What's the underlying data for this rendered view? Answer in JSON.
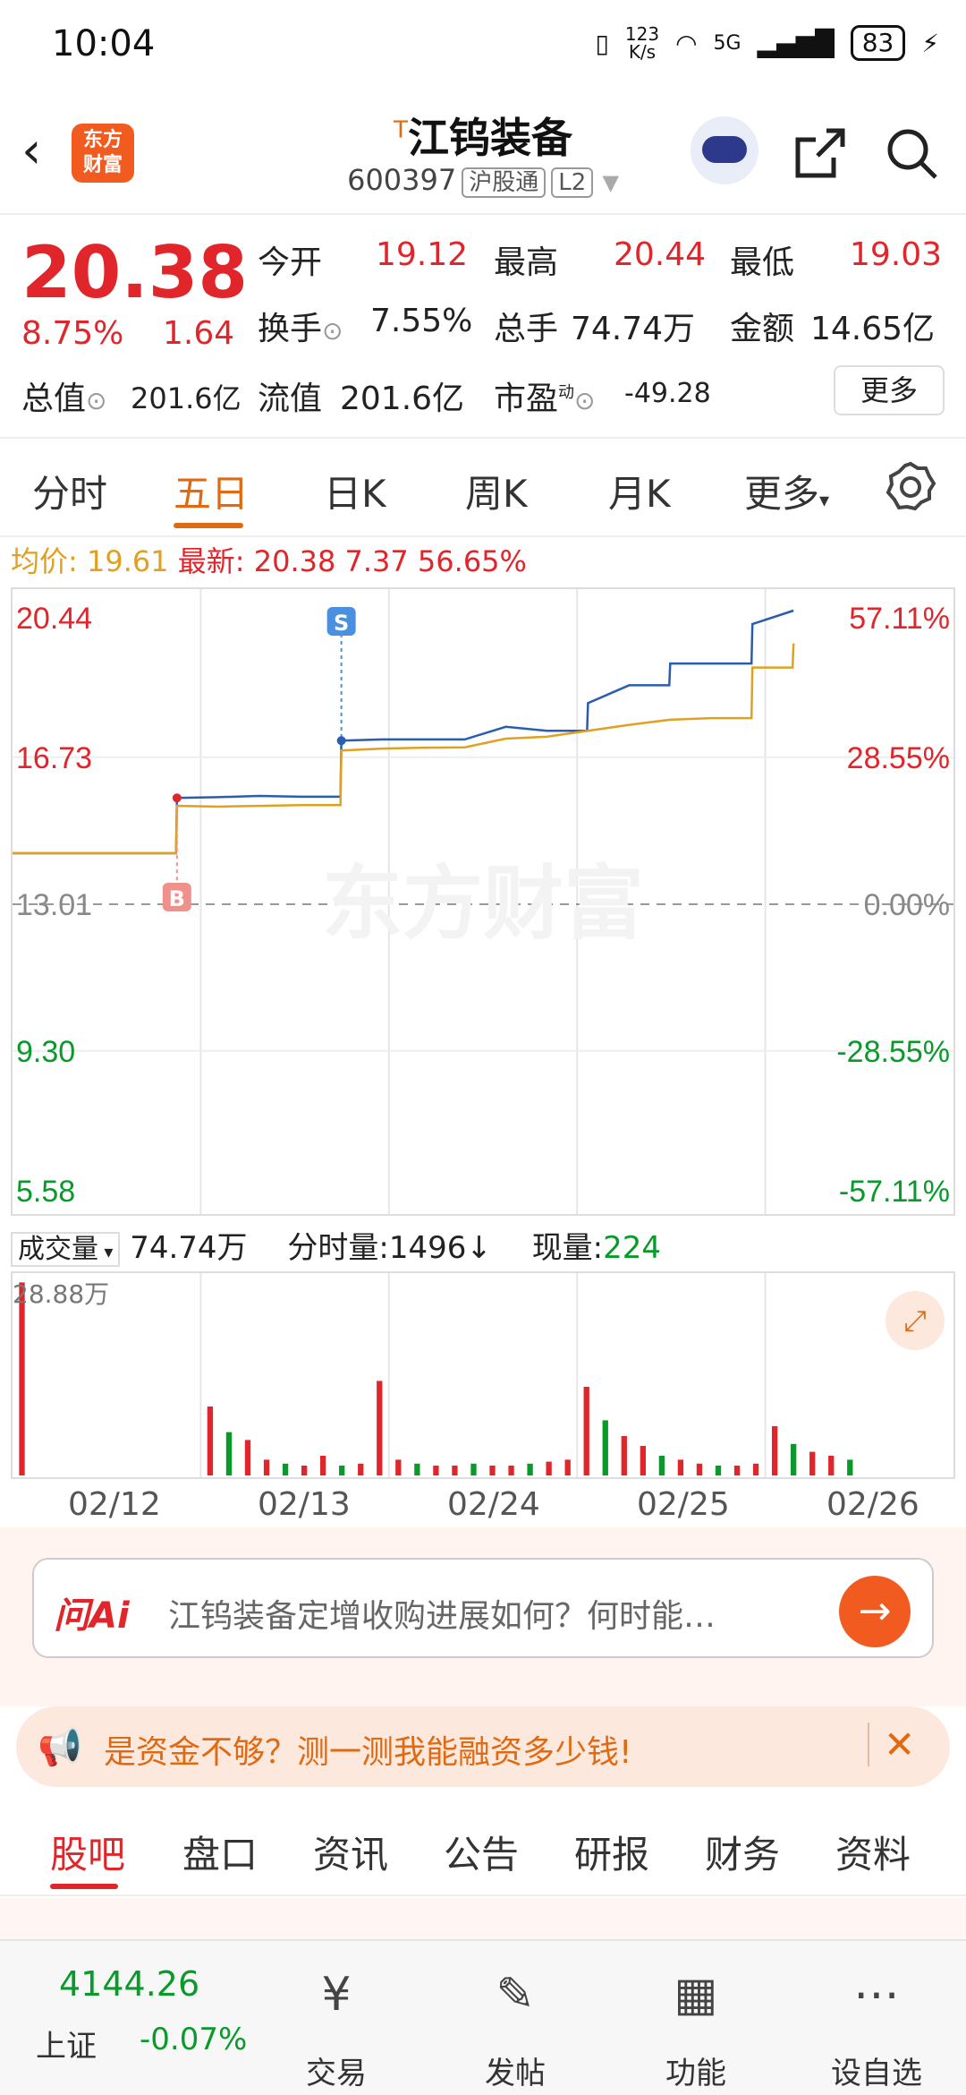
{
  "status": {
    "time": "10:04",
    "net_speed_top": "123",
    "net_speed_bottom": "K/s",
    "signal": "5G",
    "battery": "83"
  },
  "header": {
    "logo_line1": "东方",
    "logo_line2": "财富",
    "title_prefix": "T",
    "title": "江钨装备",
    "code": "600397",
    "tag1": "沪股通",
    "tag2": "L2"
  },
  "quote": {
    "price": "20.38",
    "pct": "8.75%",
    "change": "1.64",
    "open_label": "今开",
    "open": "19.12",
    "high_label": "最高",
    "high": "20.44",
    "low_label": "最低",
    "low": "19.03",
    "turnover_label": "换手",
    "turnover": "7.55%",
    "volume_label": "总手",
    "volume": "74.74万",
    "amount_label": "金额",
    "amount": "14.65亿",
    "mcap_label": "总值",
    "mcap": "201.6亿",
    "float_label": "流值",
    "float": "201.6亿",
    "pe_label": "市盈",
    "pe_sup": "动",
    "pe": "-49.28",
    "more": "更多"
  },
  "tabs": [
    "分时",
    "五日",
    "日K",
    "周K",
    "月K",
    "更多"
  ],
  "avg": {
    "avg_label": "均价:",
    "avg": "19.61",
    "last_label": "最新:",
    "last": "20.38",
    "chg": "7.37",
    "pct": "56.65%"
  },
  "chart_data": {
    "type": "line",
    "title": "",
    "xlabel": "",
    "ylabel": "",
    "categories": [
      "02/12",
      "02/13",
      "02/24",
      "02/25",
      "02/26"
    ],
    "y_left_ticks": [
      "20.44",
      "16.73",
      "13.01",
      "9.30",
      "5.58"
    ],
    "y_right_ticks": [
      "57.11%",
      "28.55%",
      "0.00%",
      "-28.55%",
      "-57.11%"
    ],
    "ylim": [
      5.58,
      20.44
    ],
    "prev_close": 13.01,
    "series": [
      {
        "values": [
          14.3,
          14.3,
          14.3,
          14.3,
          15.7,
          15.72,
          15.75,
          15.73,
          17.15,
          17.18,
          17.18,
          17.18,
          17.5,
          17.4,
          18.1,
          18.55,
          19.1,
          19.1,
          20.1,
          20.44
        ]
      },
      {
        "values": [
          14.3,
          14.3,
          14.3,
          14.3,
          15.5,
          15.48,
          15.5,
          15.52,
          16.9,
          16.95,
          16.97,
          16.98,
          17.2,
          17.25,
          17.4,
          17.55,
          17.68,
          17.72,
          19.0,
          19.61
        ]
      }
    ],
    "markers": [
      "B",
      "S"
    ],
    "watermark": "东方财富",
    "volume": {
      "label": "成交量",
      "total": "74.74万",
      "min_label": "分时量:",
      "min_value": "1496",
      "now_label": "现量:",
      "now_value": "224",
      "max_label": "28.88万",
      "days": [
        {
          "bars": [
            0.98,
            0.0,
            0.0,
            0.0,
            0.0,
            0.0,
            0.0,
            0.0,
            0.0,
            0.0
          ]
        },
        {
          "bars": [
            0.35,
            0.22,
            0.18,
            0.08,
            0.06,
            0.05,
            0.1,
            0.05,
            0.06,
            0.48
          ]
        },
        {
          "bars": [
            0.08,
            0.06,
            0.05,
            0.05,
            0.06,
            0.05,
            0.05,
            0.06,
            0.07,
            0.08
          ]
        },
        {
          "bars": [
            0.45,
            0.28,
            0.2,
            0.15,
            0.1,
            0.08,
            0.06,
            0.05,
            0.05,
            0.06
          ]
        },
        {
          "bars": [
            0.25,
            0.16,
            0.12,
            0.1,
            0.08,
            0.0,
            0.0,
            0.0,
            0.0,
            0.0
          ]
        }
      ]
    }
  },
  "ask_ai": {
    "brand": "问Ai",
    "question": "江钨装备定增收购进展如何？何时能…"
  },
  "promo": {
    "text": "是资金不够？测一测我能融资多少钱!"
  },
  "bottom_tabs": [
    "股吧",
    "盘口",
    "资讯",
    "公告",
    "研报",
    "财务",
    "资料"
  ],
  "nav": {
    "index_value": "4144.26",
    "index_name": "上证",
    "index_pct": "-0.07%",
    "trade": "交易",
    "post": "发帖",
    "func": "功能",
    "watch": "设自选"
  }
}
